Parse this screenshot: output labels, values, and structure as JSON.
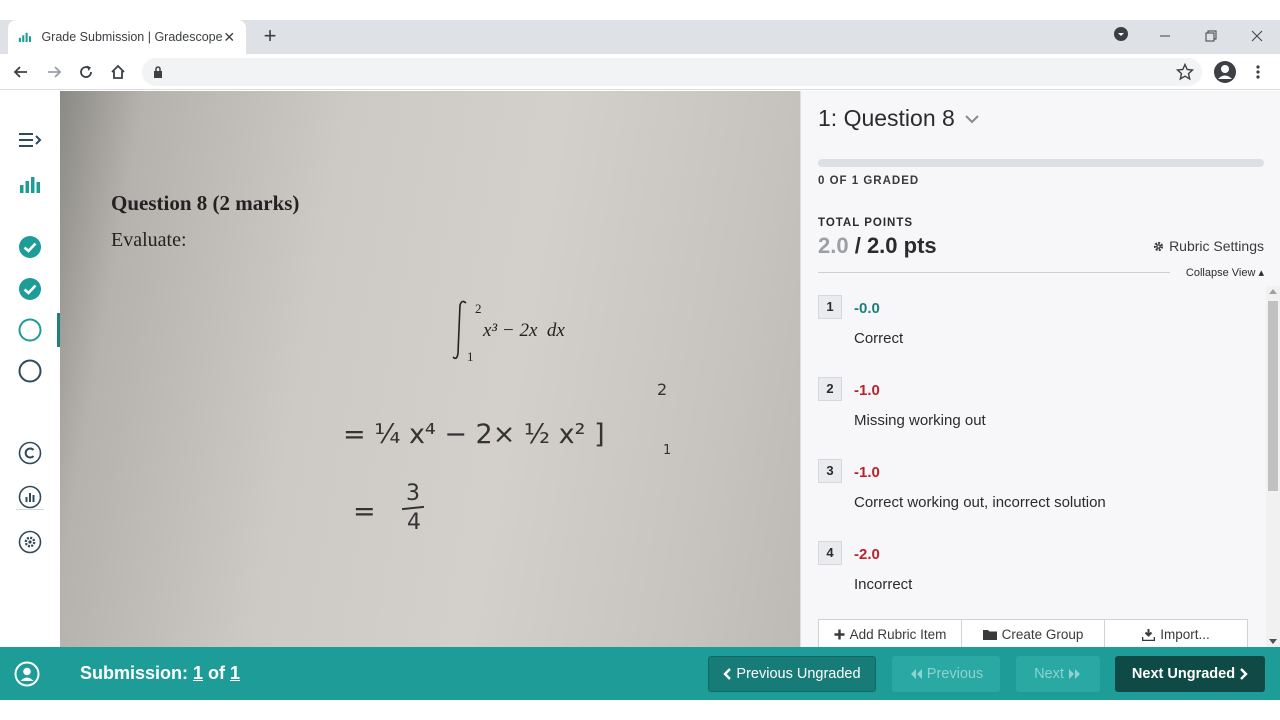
{
  "browser": {
    "tab_title": "Grade Submission | Gradescope",
    "tab_close": "✕",
    "new_tab": "+"
  },
  "submission": {
    "question_heading": "Question 8 (2 marks)",
    "instruction": "Evaluate:",
    "integral_upper": "2",
    "integral_lower": "1",
    "integrand": "x³ − 2x  dx",
    "hw_line1": "= ¼ x⁴ − 2× ½ x² ]",
    "hw_bound_upper": "2",
    "hw_bound_lower": "1",
    "hw_line2_eq": "=",
    "hw_num": "3",
    "hw_den": "4"
  },
  "panel": {
    "question_title": "1: Question 8",
    "graded_status": "0 OF 1 GRADED",
    "graded_fraction": 0,
    "total_points_label": "TOTAL POINTS",
    "earned": "2.0",
    "separator": " / ",
    "total": "2.0 pts",
    "rubric_settings": "Rubric Settings",
    "collapse_view": "Collapse View ▴",
    "rubric_items": [
      {
        "key": "1",
        "points": "-0.0",
        "desc": "Correct"
      },
      {
        "key": "2",
        "points": "-1.0",
        "desc": "Missing working out"
      },
      {
        "key": "3",
        "points": "-1.0",
        "desc": "Correct working out, incorrect solution"
      },
      {
        "key": "4",
        "points": "-2.0",
        "desc": "Incorrect"
      }
    ],
    "actions": {
      "add": "Add Rubric Item",
      "group": "Create Group",
      "import": "Import..."
    }
  },
  "bottom": {
    "submission_prefix": "Submission: ",
    "current": "1",
    "of": " of ",
    "count": "1",
    "prev_ungraded": "Previous Ungraded",
    "prev": "Previous",
    "next": "Next",
    "next_ungraded": "Next Ungraded"
  },
  "colors": {
    "accent": "#1d9c98",
    "positive": "#1e7f7c",
    "negative": "#b8232d"
  }
}
